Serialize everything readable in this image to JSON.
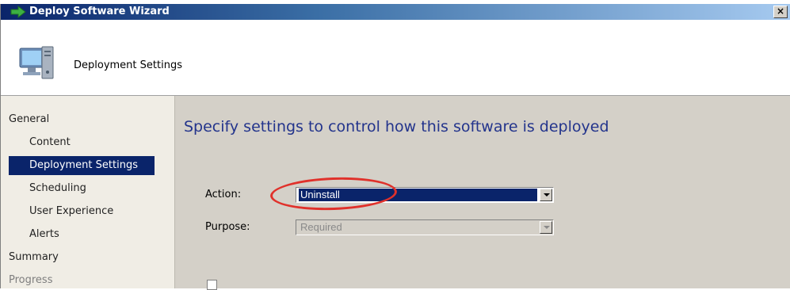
{
  "window": {
    "title": "Deploy Software Wizard",
    "close_glyph": "×"
  },
  "header": {
    "title": "Deployment Settings",
    "icon": "computer-icon"
  },
  "sidebar": {
    "items": [
      {
        "label": "General",
        "state": "normal"
      },
      {
        "label": "Content",
        "state": "normal"
      },
      {
        "label": "Deployment Settings",
        "state": "active"
      },
      {
        "label": "Scheduling",
        "state": "normal"
      },
      {
        "label": "User Experience",
        "state": "normal"
      },
      {
        "label": "Alerts",
        "state": "normal"
      },
      {
        "label": "Summary",
        "state": "normal"
      },
      {
        "label": "Progress",
        "state": "disabled"
      }
    ]
  },
  "main": {
    "heading": "Specify settings to control how this software is deployed",
    "action": {
      "label": "Action:",
      "value": "Uninstall"
    },
    "purpose": {
      "label": "Purpose:",
      "value": "Required",
      "disabled": true
    }
  },
  "colors": {
    "title_bar": "#0a246a",
    "heading": "#23348c",
    "selection": "#0a246a",
    "annotation": "#e0312b"
  }
}
